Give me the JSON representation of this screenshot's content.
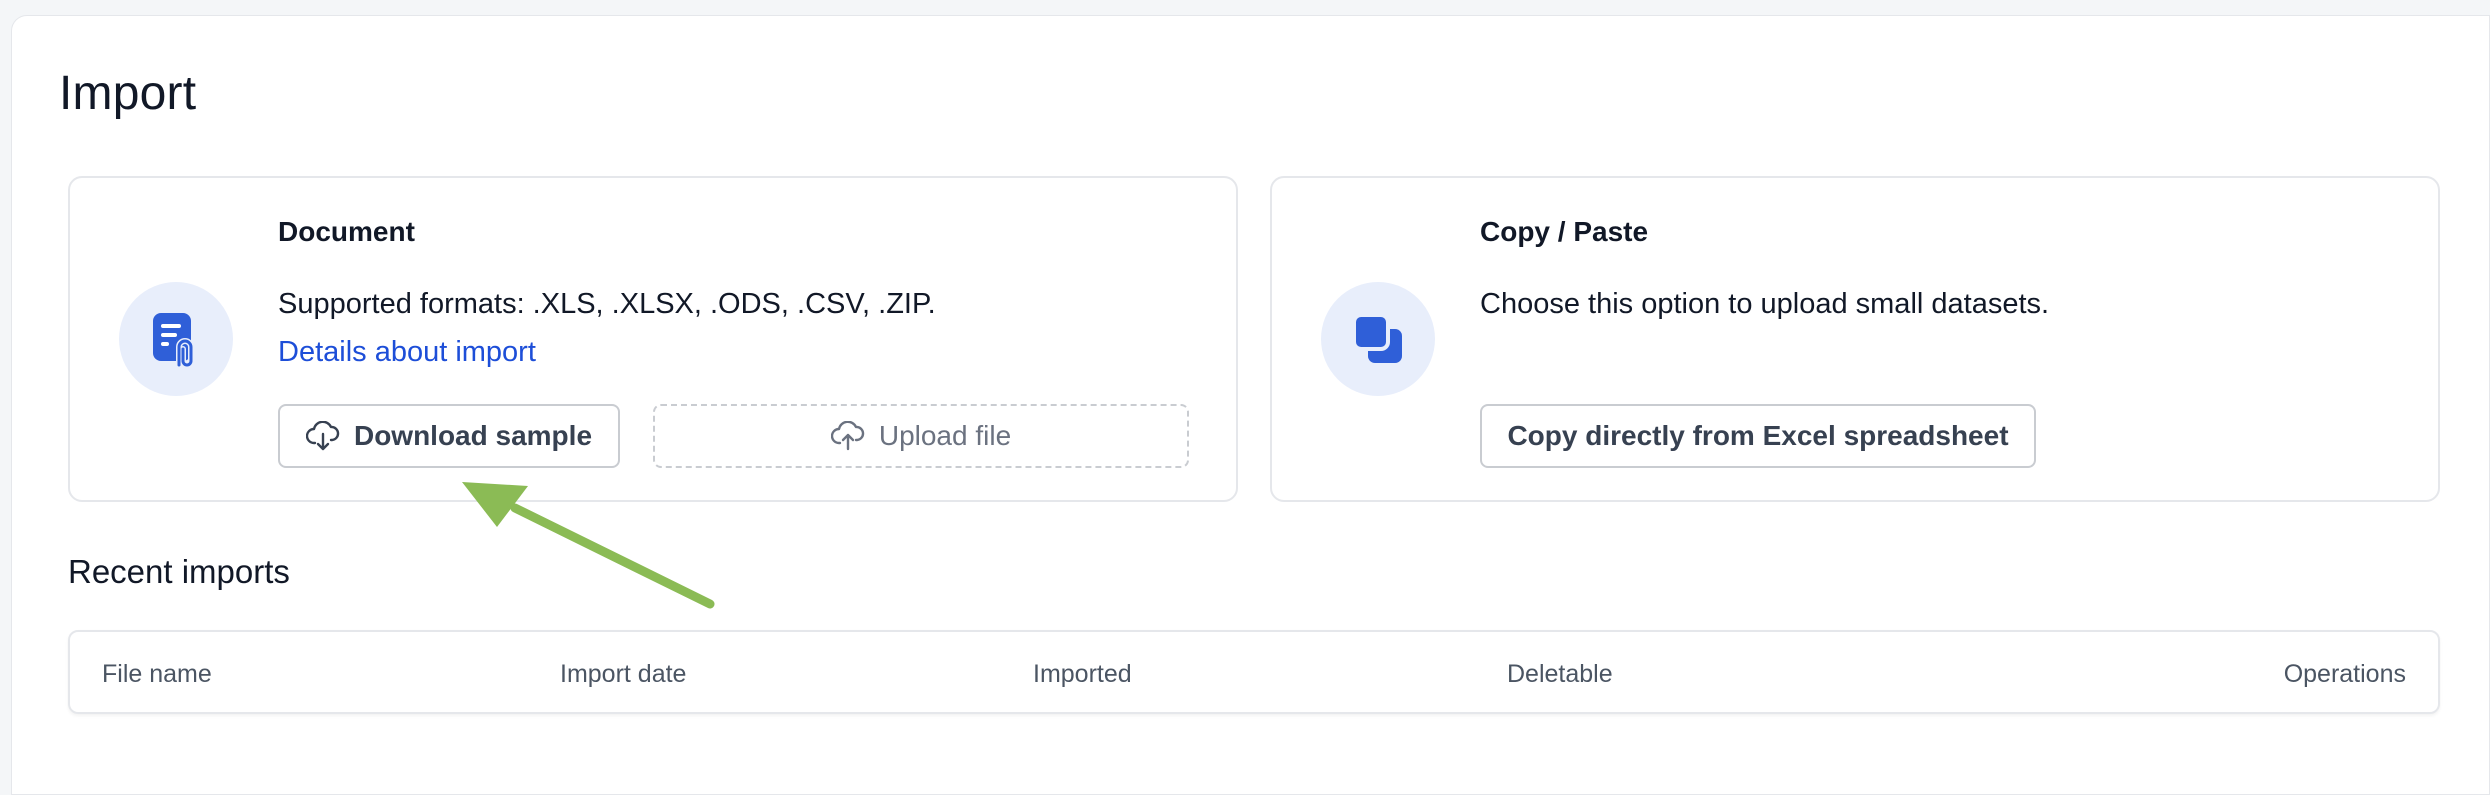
{
  "page": {
    "title": "Import"
  },
  "document_card": {
    "title": "Document",
    "description": "Supported formats: .XLS, .XLSX, .ODS, .CSV, .ZIP.",
    "link": "Details about import",
    "download_button": "Download sample",
    "upload_button": "Upload file",
    "icon": "document-attachment-icon"
  },
  "paste_card": {
    "title": "Copy / Paste",
    "description": "Choose this option to upload small datasets.",
    "button": "Copy directly from Excel spreadsheet",
    "icon": "copy-icon"
  },
  "recent_imports": {
    "title": "Recent imports",
    "columns": [
      "File name",
      "Import date",
      "Imported",
      "Deletable",
      "Operations"
    ]
  },
  "colors": {
    "accent": "#2f5fd8",
    "link": "#1d4ed8",
    "annotation_arrow": "#8bbb55"
  }
}
